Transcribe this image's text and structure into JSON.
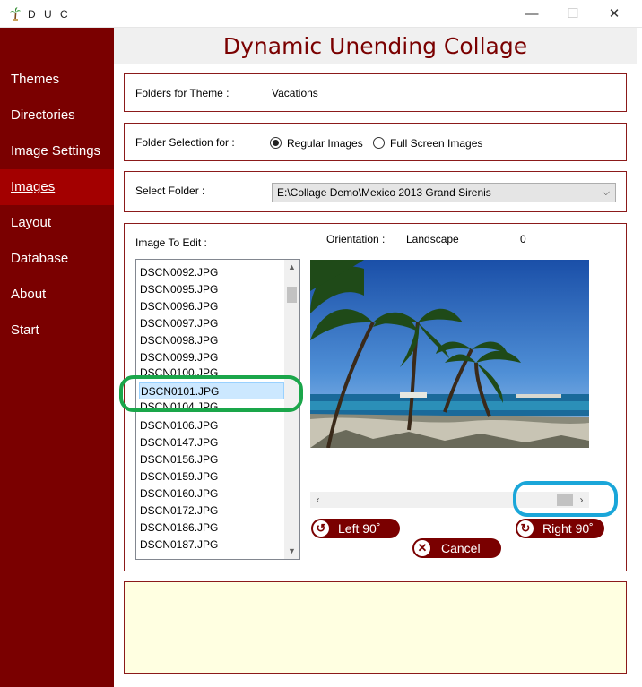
{
  "window": {
    "title": "D U C",
    "controls": {
      "minimize": "—",
      "maximize": "☐",
      "close": "✕"
    }
  },
  "sidebar": {
    "items": [
      {
        "label": "Themes"
      },
      {
        "label": "Directories"
      },
      {
        "label": "Image Settings"
      },
      {
        "label": "Images"
      },
      {
        "label": "Layout"
      },
      {
        "label": "Database"
      },
      {
        "label": "About"
      },
      {
        "label": "Start"
      }
    ],
    "active": "Images"
  },
  "header": {
    "title": "Dynamic Unending Collage"
  },
  "theme_panel": {
    "label": "Folders for Theme :",
    "value": "Vacations"
  },
  "folder_selection": {
    "label": "Folder Selection for :",
    "options": [
      {
        "label": "Regular Images",
        "checked": true
      },
      {
        "label": "Full Screen Images",
        "checked": false
      }
    ]
  },
  "select_folder": {
    "label": "Select Folder :",
    "value": "E:\\Collage Demo\\Mexico 2013 Grand Sirenis"
  },
  "image_edit": {
    "label": "Image To Edit :",
    "orientation_label": "Orientation :",
    "orientation_value": "Landscape",
    "rotation_value": "0",
    "files": [
      "DSCN0092.JPG",
      "DSCN0095.JPG",
      "DSCN0096.JPG",
      "DSCN0097.JPG",
      "DSCN0098.JPG",
      "DSCN0099.JPG",
      "DSCN0100.JPG",
      "DSCN0101.JPG",
      "DSCN0104.JPG",
      "DSCN0106.JPG",
      "DSCN0147.JPG",
      "DSCN0156.JPG",
      "DSCN0159.JPG",
      "DSCN0160.JPG",
      "DSCN0172.JPG",
      "DSCN0186.JPG",
      "DSCN0187.JPG"
    ],
    "selected_file": "DSCN0101.JPG",
    "rotate_left_label": "Left 90˚",
    "rotate_right_label": "Right 90˚",
    "cancel_label": "Cancel"
  },
  "colors": {
    "sidebar": "#7a0000",
    "sidebar_active": "#a30000",
    "accent": "#7a0000",
    "selection_callout": "#1aa64a",
    "scroll_callout": "#1aa6d9",
    "notes_bg": "#ffffe1"
  },
  "icons": {
    "app": "palm-tree-icon",
    "rotate_left": "rotate-left-icon",
    "rotate_right": "rotate-right-icon",
    "cancel": "cancel-x-icon"
  }
}
